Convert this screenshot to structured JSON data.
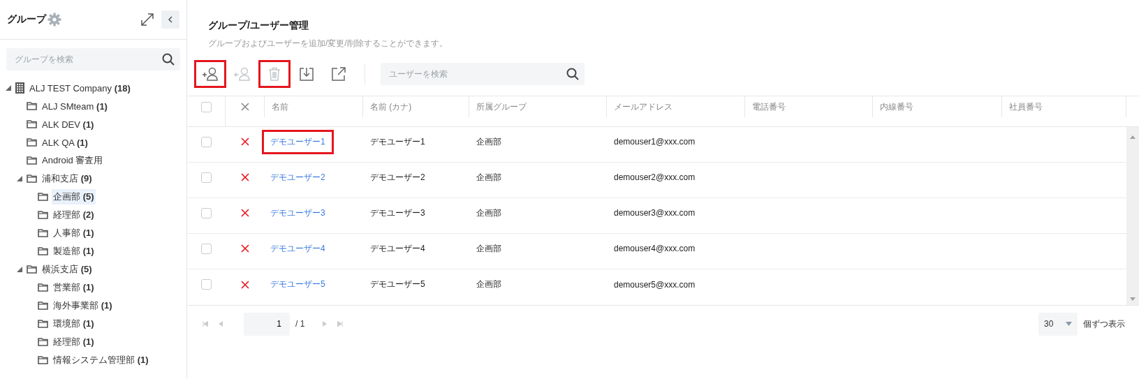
{
  "sidebar": {
    "title": "グループ",
    "search": {
      "placeholder": "グループを検索"
    },
    "tree": [
      {
        "kind": "company",
        "label": "ALJ TEST Company",
        "count": "(18)",
        "selected": false,
        "expanded": true,
        "children": [
          {
            "kind": "folder",
            "label": "ALJ SMteam",
            "count": "(1)",
            "selected": false
          },
          {
            "kind": "folder",
            "label": "ALK DEV",
            "count": "(1)",
            "selected": false
          },
          {
            "kind": "folder",
            "label": "ALK QA",
            "count": "(1)",
            "selected": false
          },
          {
            "kind": "folder",
            "label": "Android 審査用",
            "selected": false
          },
          {
            "kind": "folder",
            "label": "浦和支店",
            "count": "(9)",
            "selected": false,
            "expanded": true,
            "children": [
              {
                "kind": "folder",
                "label": "企画部",
                "count": "(5)",
                "selected": true
              },
              {
                "kind": "folder",
                "label": "経理部",
                "count": "(2)",
                "selected": false
              },
              {
                "kind": "folder",
                "label": "人事部",
                "count": "(1)",
                "selected": false
              },
              {
                "kind": "folder",
                "label": "製造部",
                "count": "(1)",
                "selected": false
              }
            ]
          },
          {
            "kind": "folder",
            "label": "横浜支店",
            "count": "(5)",
            "selected": false,
            "expanded": true,
            "children": [
              {
                "kind": "folder",
                "label": "営業部",
                "count": "(1)",
                "selected": false
              },
              {
                "kind": "folder",
                "label": "海外事業部",
                "count": "(1)",
                "selected": false
              },
              {
                "kind": "folder",
                "label": "環境部",
                "count": "(1)",
                "selected": false
              },
              {
                "kind": "folder",
                "label": "経理部",
                "count": "(1)",
                "selected": false
              },
              {
                "kind": "folder",
                "label": "情報システム管理部",
                "count": "(1)",
                "selected": false
              }
            ]
          }
        ]
      }
    ]
  },
  "main": {
    "title": "グループ/ユーザー管理",
    "subtitle": "グループおよびユーザーを追加/変更/削除することができます。",
    "toolbar": [
      {
        "kind": "add_user",
        "disabled": false,
        "highlighted": true
      },
      {
        "kind": "remove_user",
        "disabled": true,
        "highlighted": false
      },
      {
        "kind": "delete",
        "disabled": true,
        "highlighted": true
      },
      {
        "kind": "download",
        "disabled": false,
        "highlighted": false
      },
      {
        "kind": "export",
        "disabled": false,
        "highlighted": false
      }
    ],
    "search": {
      "placeholder": "ユーザーを検索"
    },
    "table": {
      "all_checked": false,
      "columns": [
        "名前",
        "名前 (カナ)",
        "所属グループ",
        "メールアドレス",
        "電話番号",
        "内線番号",
        "社員番号"
      ],
      "rows": [
        {
          "checked": false,
          "highlighted": true,
          "name": "デモユーザー1",
          "kana": "デモユーザー1",
          "group": "企画部",
          "email": "demouser1@xxx.com"
        },
        {
          "checked": false,
          "highlighted": false,
          "name": "デモユーザー2",
          "kana": "デモユーザー2",
          "group": "企画部",
          "email": "demouser2@xxx.com"
        },
        {
          "checked": false,
          "highlighted": false,
          "name": "デモユーザー3",
          "kana": "デモユーザー3",
          "group": "企画部",
          "email": "demouser3@xxx.com"
        },
        {
          "checked": false,
          "highlighted": false,
          "name": "デモユーザー4",
          "kana": "デモユーザー4",
          "group": "企画部",
          "email": "demouser4@xxx.com"
        },
        {
          "checked": false,
          "highlighted": false,
          "name": "デモユーザー5",
          "kana": "デモユーザー5",
          "group": "企画部",
          "email": "demouser5@xxx.com"
        }
      ]
    },
    "pagination": {
      "page": "1",
      "total": "/ 1",
      "page_size": "30",
      "page_size_label": "個ずつ表示"
    }
  }
}
